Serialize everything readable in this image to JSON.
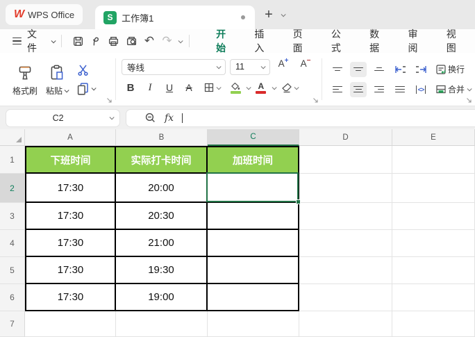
{
  "colors": {
    "accent_teal_green": "#0e7d5a",
    "selection_green": "#217346",
    "header_cell_fill": "#92d050",
    "font_color_swatch": "#d92b2b",
    "fill_color_swatch": "#92d050",
    "icon_blue": "#4365c8",
    "wps_logo_red": "#e23c2b",
    "sheet_badge_green": "#21a464",
    "black_table_border": "#000000"
  },
  "titlebar": {
    "app_name": "WPS Office",
    "tab_title": "工作簿1",
    "plus": "+"
  },
  "menubar": {
    "file_label": "文件",
    "tabs": [
      {
        "label": "开始"
      },
      {
        "label": "插入"
      },
      {
        "label": "页面"
      },
      {
        "label": "公式"
      },
      {
        "label": "数据"
      },
      {
        "label": "审阅"
      },
      {
        "label": "视图"
      }
    ],
    "active_tab": "开始",
    "undo_glyph": "↶",
    "redo_glyph": "↷"
  },
  "toolbar": {
    "format_painter_label": "格式刷",
    "paste_label": "粘贴",
    "font_name": "等线",
    "font_size": "11",
    "bold": "B",
    "italic": "I",
    "underline": "U",
    "strikethrough": "A",
    "font_size_up": "A",
    "font_size_up_sup": "+",
    "font_size_down": "A",
    "font_size_down_sup": "−",
    "font_color_letter": "A",
    "wrap_label": "换行",
    "merge_label": "合并",
    "spacing_glyph": "<>"
  },
  "formula_bar": {
    "name_box_value": "C2",
    "fx_label": "fx",
    "formula_value": ""
  },
  "sheet": {
    "selected_cell": "C2",
    "selected_column": "C",
    "selected_row": "2",
    "col_headers": [
      "A",
      "B",
      "C",
      "D",
      "E"
    ],
    "rows": [
      {
        "num": "1",
        "cells": [
          "下班时间",
          "实际打卡时间",
          "加班时间",
          "",
          ""
        ]
      },
      {
        "num": "2",
        "cells": [
          "17:30",
          "20:00",
          "",
          "",
          ""
        ]
      },
      {
        "num": "3",
        "cells": [
          "17:30",
          "20:30",
          "",
          "",
          ""
        ]
      },
      {
        "num": "4",
        "cells": [
          "17:30",
          "21:00",
          "",
          "",
          ""
        ]
      },
      {
        "num": "5",
        "cells": [
          "17:30",
          "19:30",
          "",
          "",
          ""
        ]
      },
      {
        "num": "6",
        "cells": [
          "17:30",
          "19:00",
          "",
          "",
          ""
        ]
      },
      {
        "num": "7",
        "cells": [
          "",
          "",
          "",
          "",
          ""
        ]
      }
    ]
  }
}
